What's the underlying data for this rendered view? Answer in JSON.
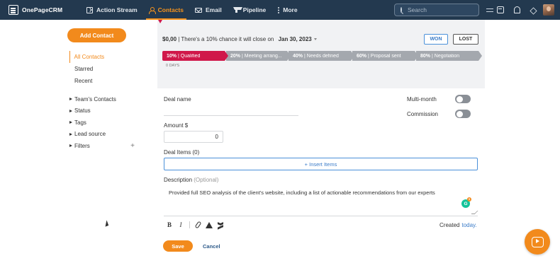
{
  "app": {
    "logo_text": "OnePageCRM"
  },
  "nav": {
    "items": [
      {
        "label": "Action Stream",
        "icon": "action-stream-icon"
      },
      {
        "label": "Contacts",
        "icon": "contacts-icon",
        "active": true
      },
      {
        "label": "Email",
        "icon": "email-icon"
      },
      {
        "label": "Pipeline",
        "icon": "pipeline-icon"
      },
      {
        "label": "More",
        "icon": "more-icon"
      }
    ],
    "search_placeholder": "Search"
  },
  "sidebar": {
    "add_contact_label": "Add Contact",
    "items": [
      {
        "label": "All Contacts",
        "active": true
      },
      {
        "label": "Starred"
      },
      {
        "label": "Recent"
      }
    ],
    "groups": [
      {
        "label": "Team's Contacts"
      },
      {
        "label": "Status"
      },
      {
        "label": "Tags"
      },
      {
        "label": "Lead source"
      },
      {
        "label": "Filters",
        "addable": true
      }
    ],
    "filters_add_symbol": "+"
  },
  "deal": {
    "amount_text": "$0,00",
    "chance_text": " | There's a 10% chance it will close on ",
    "close_date": "Jan 30, 2023",
    "won_label": "WON",
    "lost_label": "LOST",
    "stages": [
      {
        "pct": "10%",
        "label": "| Qualified",
        "active": true
      },
      {
        "pct": "20%",
        "label": "| Meeting arrang..."
      },
      {
        "pct": "40%",
        "label": "| Needs defined"
      },
      {
        "pct": "60%",
        "label": "| Proposal sent"
      },
      {
        "pct": "80%",
        "label": "| Negotiation"
      }
    ],
    "days_in_stage": "0 DAYS",
    "accent_color": "#d0184a"
  },
  "form": {
    "deal_name_label": "Deal name",
    "deal_name_value": "",
    "multi_month_label": "Multi-month",
    "multi_month_on": false,
    "commission_label": "Commission",
    "commission_on": false,
    "amount_label": "Amount $",
    "amount_value": "0",
    "deal_items_label": "Deal Items",
    "deal_items_count": "(0)",
    "insert_items_label": "+ Insert Items",
    "description_label": "Description",
    "description_optional": "(Optional)",
    "description_value": "Provided full SEO analysis of the client's website, including a list of actionable recommendations from our experts",
    "grammarly_letter": "G",
    "grammarly_count": "1",
    "toolbar": {
      "bold": "B",
      "italic": "I"
    },
    "created_label": "Created",
    "created_value": "today.",
    "save_label": "Save",
    "cancel_label": "Cancel"
  },
  "colors": {
    "brand_orange": "#f28a1c",
    "nav_bg": "#23394f",
    "link_blue": "#3a7bc8"
  }
}
